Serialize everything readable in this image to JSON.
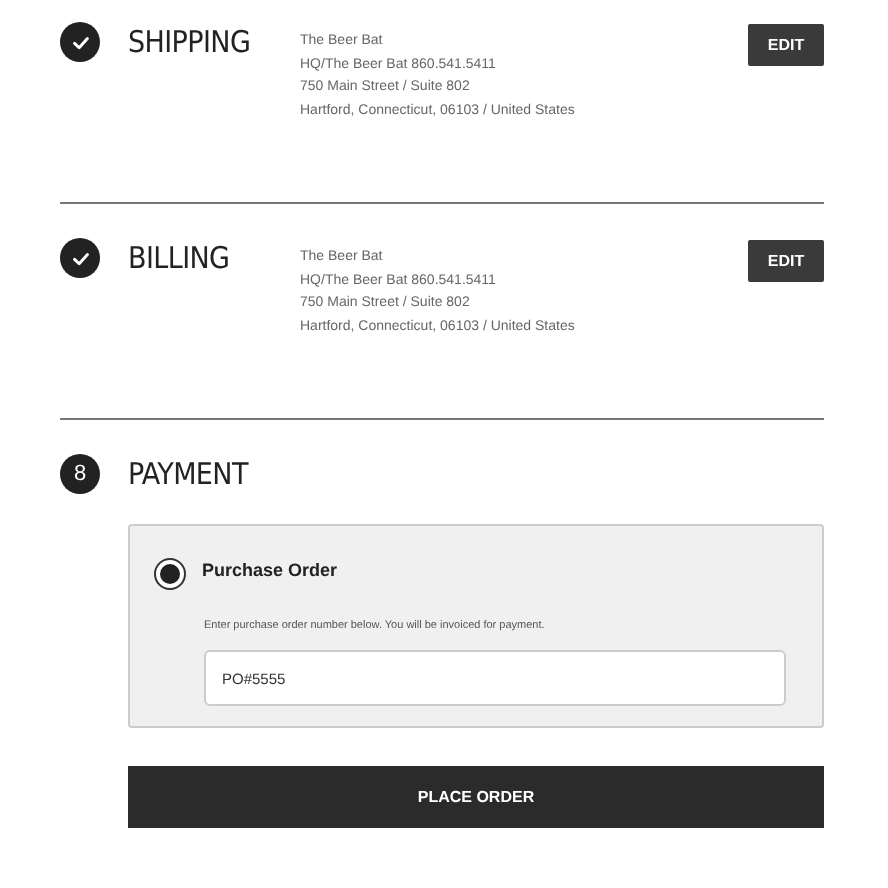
{
  "steps": [
    {
      "kind": "complete",
      "title": "SHIPPING",
      "address": [
        "The Beer Bat",
        "HQ/The Beer Bat 860.541.5411",
        "750 Main Street / Suite 802",
        "Hartford, Connecticut, 06103 / United States"
      ],
      "edit_button": "EDIT"
    },
    {
      "kind": "complete",
      "title": "BILLING",
      "address": [
        "The Beer Bat",
        "HQ/The Beer Bat 860.541.5411",
        "750 Main Street / Suite 802",
        "Hartford, Connecticut, 06103 / United States"
      ],
      "edit_button": "EDIT"
    },
    {
      "kind": "numbered",
      "number": "8",
      "title": "PAYMENT"
    }
  ],
  "payment_option": {
    "label": "Purchase Order",
    "selected": true,
    "hint": "Enter purchase order number below. You will be invoiced for payment.",
    "value": "PO#5555"
  },
  "place_order_button": "PLACE ORDER"
}
